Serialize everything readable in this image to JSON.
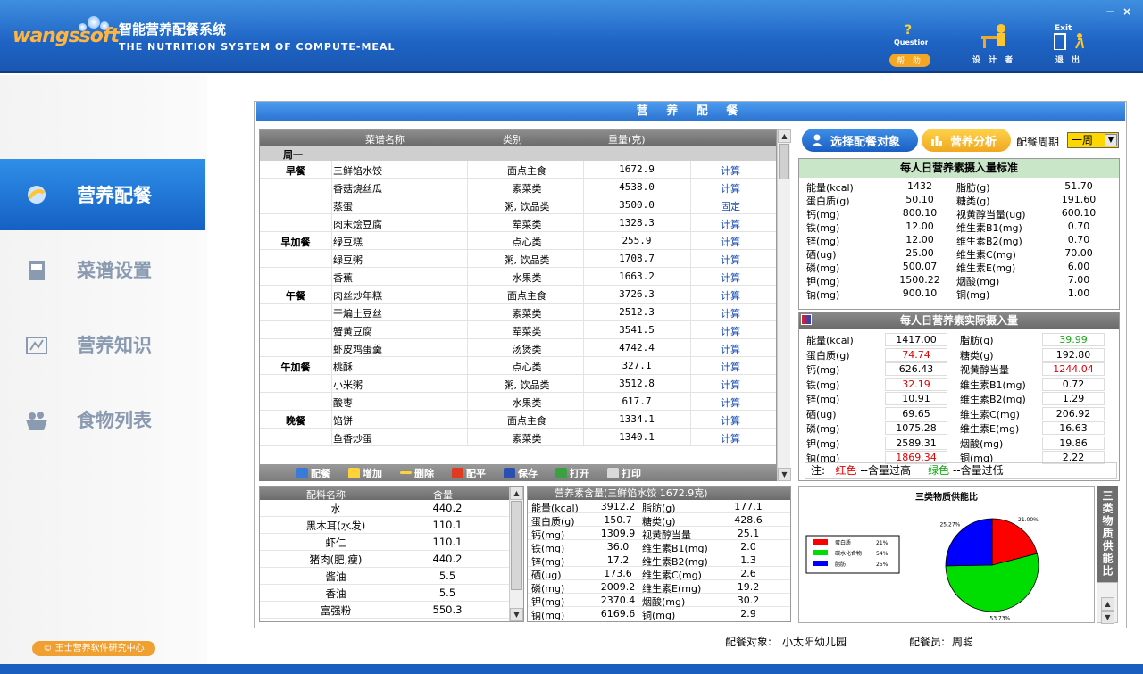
{
  "header": {
    "logo": "wangssoft",
    "title": "智能营养配餐系统",
    "subtitle": "THE NUTRITION SYSTEM OF COMPUTE-MEAL",
    "help_top": "Question?",
    "help_label": "帮 助",
    "designer_label": "设 计 者",
    "exit_top": "Exit",
    "exit_label": "退 出",
    "minimize": "−",
    "close": "×"
  },
  "sidebar": {
    "items": [
      {
        "label": "营养配餐"
      },
      {
        "label": "菜谱设置"
      },
      {
        "label": "营养知识"
      },
      {
        "label": "食物列表"
      }
    ],
    "copyright": "© 王士营养软件研究中心"
  },
  "main_title": "营 养 配 餐",
  "recipes": {
    "headers": [
      "菜谱名称",
      "类别",
      "重量(克)"
    ],
    "day": "周一",
    "rows": [
      {
        "meal": "早餐",
        "name": "三鲜馅水饺",
        "cat": "面点主食",
        "wt": "1672.9",
        "act": "计算"
      },
      {
        "meal": "",
        "name": "香菇烧丝瓜",
        "cat": "素菜类",
        "wt": "4538.0",
        "act": "计算"
      },
      {
        "meal": "",
        "name": "蒸蛋",
        "cat": "粥, 饮品类",
        "wt": "3500.0",
        "act": "固定"
      },
      {
        "meal": "",
        "name": "肉末烩豆腐",
        "cat": "荤菜类",
        "wt": "1328.3",
        "act": "计算"
      },
      {
        "meal": "早加餐",
        "name": "绿豆糕",
        "cat": "点心类",
        "wt": "255.9",
        "act": "计算"
      },
      {
        "meal": "",
        "name": "绿豆粥",
        "cat": "粥, 饮品类",
        "wt": "1708.7",
        "act": "计算"
      },
      {
        "meal": "",
        "name": "香蕉",
        "cat": "水果类",
        "wt": "1663.2",
        "act": "计算"
      },
      {
        "meal": "午餐",
        "name": "肉丝炒年糕",
        "cat": "面点主食",
        "wt": "3726.3",
        "act": "计算"
      },
      {
        "meal": "",
        "name": "干煸土豆丝",
        "cat": "素菜类",
        "wt": "2512.3",
        "act": "计算"
      },
      {
        "meal": "",
        "name": "蟹黄豆腐",
        "cat": "荤菜类",
        "wt": "3541.5",
        "act": "计算"
      },
      {
        "meal": "",
        "name": "虾皮鸡蛋羹",
        "cat": "汤煲类",
        "wt": "4742.4",
        "act": "计算"
      },
      {
        "meal": "午加餐",
        "name": "桃酥",
        "cat": "点心类",
        "wt": "327.1",
        "act": "计算"
      },
      {
        "meal": "",
        "name": "小米粥",
        "cat": "粥, 饮品类",
        "wt": "3512.8",
        "act": "计算"
      },
      {
        "meal": "",
        "name": "酸枣",
        "cat": "水果类",
        "wt": "617.7",
        "act": "计算"
      },
      {
        "meal": "晚餐",
        "name": "馅饼",
        "cat": "面点主食",
        "wt": "1334.1",
        "act": "计算"
      },
      {
        "meal": "",
        "name": "鱼香炒蛋",
        "cat": "素菜类",
        "wt": "1340.1",
        "act": "计算"
      }
    ]
  },
  "toolbar": {
    "peican": "配餐",
    "add": "增加",
    "del": "删除",
    "balance": "配平",
    "save": "保存",
    "open": "打开",
    "print": "打印"
  },
  "right": {
    "select_target": "选择配餐对象",
    "analysis": "营养分析",
    "period_label": "配餐周期",
    "period_value": "一周"
  },
  "standard": {
    "title": "每人日营养素摄入量标准",
    "left": [
      [
        "能量(kcal)",
        "1432"
      ],
      [
        "蛋白质(g)",
        "50.10"
      ],
      [
        "钙(mg)",
        "800.10"
      ],
      [
        "铁(mg)",
        "12.00"
      ],
      [
        "锌(mg)",
        "12.00"
      ],
      [
        "硒(ug)",
        "25.00"
      ],
      [
        "磷(mg)",
        "500.07"
      ],
      [
        "钾(mg)",
        "1500.22"
      ],
      [
        "钠(mg)",
        "900.10"
      ]
    ],
    "right": [
      [
        "脂肪(g)",
        "51.70"
      ],
      [
        "糖类(g)",
        "191.60"
      ],
      [
        "视黄醇当量(ug)",
        "600.10"
      ],
      [
        "维生素B1(mg)",
        "0.70"
      ],
      [
        "维生素B2(mg)",
        "0.70"
      ],
      [
        "维生素C(mg)",
        "70.00"
      ],
      [
        "维生素E(mg)",
        "6.00"
      ],
      [
        "烟酸(mg)",
        "7.00"
      ],
      [
        "铜(mg)",
        "1.00"
      ]
    ]
  },
  "actual": {
    "title": "每人日营养素实际摄入量",
    "left": [
      [
        "能量(kcal)",
        "1417.00",
        ""
      ],
      [
        "蛋白质(g)",
        "74.74",
        "red"
      ],
      [
        "钙(mg)",
        "626.43",
        ""
      ],
      [
        "铁(mg)",
        "32.19",
        "red"
      ],
      [
        "锌(mg)",
        "10.91",
        ""
      ],
      [
        "硒(ug)",
        "69.65",
        ""
      ],
      [
        "磷(mg)",
        "1075.28",
        ""
      ],
      [
        "钾(mg)",
        "2589.31",
        ""
      ],
      [
        "钠(mg)",
        "1869.34",
        "red"
      ]
    ],
    "right": [
      [
        "脂肪(g)",
        "39.99",
        "green"
      ],
      [
        "糖类(g)",
        "192.80",
        ""
      ],
      [
        "视黄醇当量",
        "1244.04",
        "red"
      ],
      [
        "维生素B1(mg)",
        "0.72",
        ""
      ],
      [
        "维生素B2(mg)",
        "1.29",
        ""
      ],
      [
        "维生素C(mg)",
        "206.92",
        ""
      ],
      [
        "维生素E(mg)",
        "16.63",
        ""
      ],
      [
        "烟酸(mg)",
        "19.86",
        ""
      ],
      [
        "铜(mg)",
        "2.22",
        ""
      ]
    ],
    "note_prefix": "注:",
    "note_red": "红色",
    "note_red_desc": "--含量过高",
    "note_green": "绿色",
    "note_green_desc": "--含量过低"
  },
  "ingredients": {
    "headers": [
      "配料名称",
      "含量"
    ],
    "rows": [
      [
        "水",
        "440.2"
      ],
      [
        "黑木耳(水发)",
        "110.1"
      ],
      [
        "虾仁",
        "110.1"
      ],
      [
        "猪肉(肥,瘦)",
        "440.2"
      ],
      [
        "酱油",
        "5.5"
      ],
      [
        "香油",
        "5.5"
      ],
      [
        "富强粉",
        "550.3"
      ]
    ]
  },
  "nutrients": {
    "title": "营养素含量(三鲜馅水饺 1672.9克)",
    "rows": [
      [
        "能量(kcal)",
        "3912.2",
        "脂肪(g)",
        "177.1"
      ],
      [
        "蛋白质(g)",
        "150.7",
        "糖类(g)",
        "428.6"
      ],
      [
        "钙(mg)",
        "1309.9",
        "视黄醇当量",
        "25.1"
      ],
      [
        "铁(mg)",
        "36.0",
        "维生素B1(mg)",
        "2.0"
      ],
      [
        "锌(mg)",
        "17.2",
        "维生素B2(mg)",
        "1.3"
      ],
      [
        "硒(ug)",
        "173.6",
        "维生素C(mg)",
        "2.6"
      ],
      [
        "磷(mg)",
        "2009.2",
        "维生素E(mg)",
        "19.2"
      ],
      [
        "钾(mg)",
        "2370.4",
        "烟酸(mg)",
        "30.2"
      ],
      [
        "钠(mg)",
        "6169.6",
        "铜(mg)",
        "2.9"
      ]
    ]
  },
  "chart_data": {
    "type": "pie",
    "title": "三类物质供能比",
    "categories": [
      "蛋白质",
      "碳水化合物",
      "脂肪"
    ],
    "values": [
      21.0,
      53.73,
      25.27
    ],
    "value_labels": [
      "21.00%",
      "53.73%",
      "25.27%"
    ],
    "legend_values": [
      "21%",
      "54%",
      "25%"
    ],
    "colors": [
      "#ff0000",
      "#00dd00",
      "#0000ff"
    ],
    "legend": "left"
  },
  "chart_tab": "三类物质供能比",
  "footer": {
    "target_label": "配餐对象:",
    "target_value": "小太阳幼儿园",
    "staff_label": "配餐员:",
    "staff_value": "周聪"
  }
}
